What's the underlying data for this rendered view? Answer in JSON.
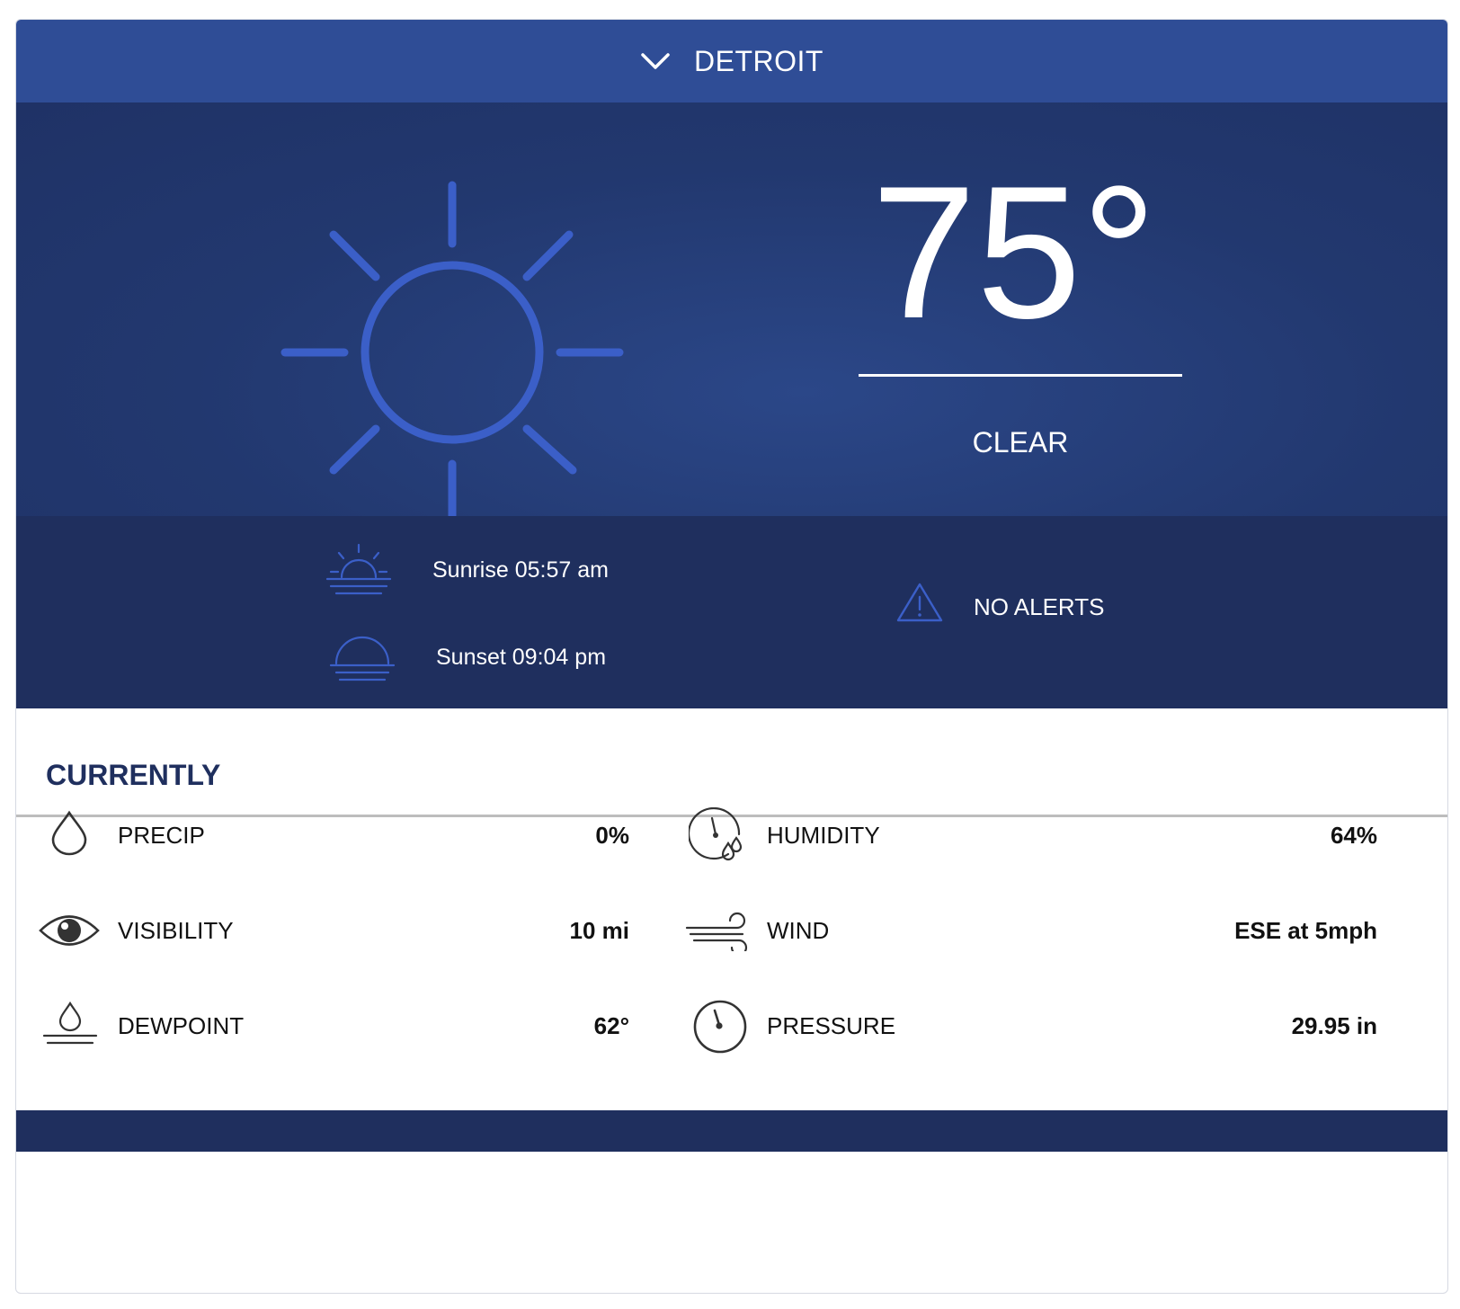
{
  "header": {
    "city": "DETROIT",
    "toggle_icon": "chevron-down-icon"
  },
  "current": {
    "temperature": "75°",
    "condition": "CLEAR",
    "condition_icon": "sun-icon"
  },
  "sun": {
    "sunrise": "Sunrise 05:57 am",
    "sunset": "Sunset 09:04 pm"
  },
  "alerts": {
    "text": "NO ALERTS",
    "icon": "warning-icon"
  },
  "section": {
    "title": "CURRENTLY"
  },
  "metrics": [
    {
      "label": "PRECIP",
      "value": "0%",
      "icon": "raindrop-icon"
    },
    {
      "label": "HUMIDITY",
      "value": "64%",
      "icon": "humidity-gauge-icon"
    },
    {
      "label": "VISIBILITY",
      "value": "10 mi",
      "icon": "eye-icon"
    },
    {
      "label": "WIND",
      "value": "ESE at 5mph",
      "icon": "wind-icon"
    },
    {
      "label": "DEWPOINT",
      "value": "62°",
      "icon": "dewpoint-icon"
    },
    {
      "label": "PRESSURE",
      "value": "29.95 in",
      "icon": "pressure-gauge-icon"
    }
  ],
  "colors": {
    "header": "#2f4d96",
    "hero": "#22386f",
    "band": "#1f2f5e",
    "accent": "#3b5fc8",
    "section_title": "#1f2f5e"
  }
}
